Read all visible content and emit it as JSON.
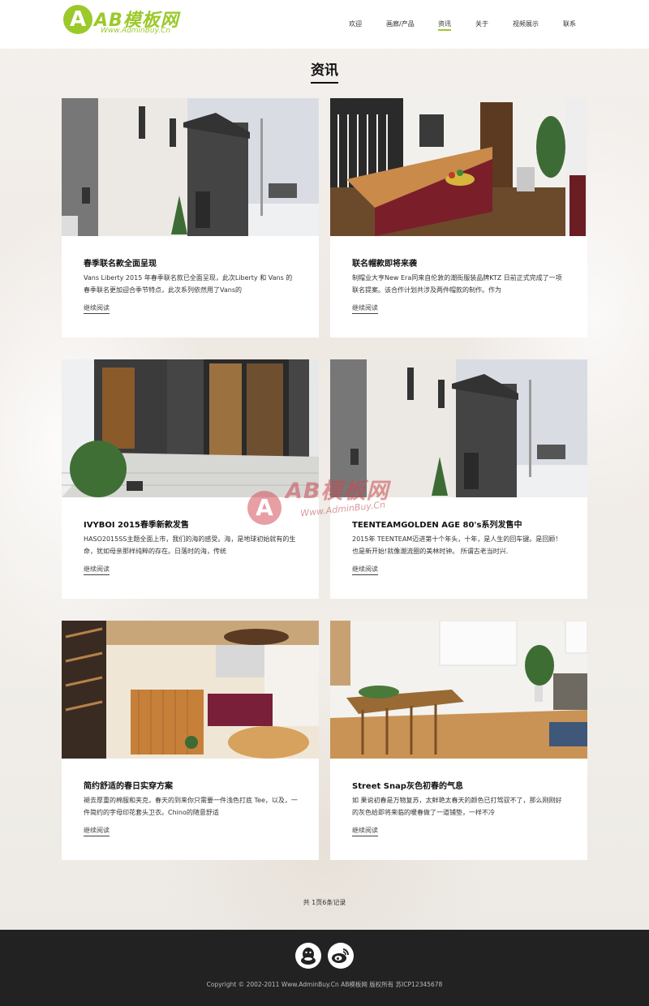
{
  "header": {
    "logo": {
      "mark": "A",
      "text": "AB模板网",
      "subtext": "Www.AdminBuy.Cn"
    },
    "nav": [
      {
        "label": "欢迎",
        "active": false
      },
      {
        "label": "画廊/产品",
        "active": false
      },
      {
        "label": "资讯",
        "active": true
      },
      {
        "label": "关于",
        "active": false
      },
      {
        "label": "视频展示",
        "active": false
      },
      {
        "label": "联系",
        "active": false
      }
    ],
    "accent_color": "#9bc92a"
  },
  "main": {
    "title": "资讯",
    "articles": [
      {
        "title": "春季联名款全面呈现",
        "excerpt": "Vans Liberty 2015 年春季联名款已全面呈现，此次Liberty 和 Vans 的春季联名更加迎合季节特点，此次系列依然用了Vans的",
        "more": "继续阅读",
        "image": "house-exterior-snow"
      },
      {
        "title": "联名帽款即将来袭",
        "excerpt": "制帽业大亨New Era同来自伦敦的潮街服装品牌KTZ 日前正式完成了一项联名提案。该合作计划共涉及两件帽款的制作。作为",
        "more": "继续阅读",
        "image": "kitchen-interior"
      },
      {
        "title": "IVYBOI 2015春季新款发售",
        "excerpt": "HASO2015SS主题全面上市，我们的海的感受。海，是地球初始就有的生命，犹如母亲那样纯粹的存在。日落时的海，传统",
        "more": "继续阅读",
        "image": "patio-glass-door"
      },
      {
        "title": "TEENTEAMGOLDEN AGE 80's系列发售中",
        "excerpt": "2015年 TEENTEAM迈进第十个年头，十年，是人生的回车键。是回顾！也是新开始!就像潮流圈的美林时钟。 所谓古老当时兴.",
        "more": "继续阅读",
        "image": "house-exterior-snow"
      },
      {
        "title": "简约舒适的春日实穿方案",
        "excerpt": "褪去厚重的棉服和夹克，春天的到来你只需要一件浅色打底 Tee，以及，一件简约的字母印花套头卫衣。Chino的随意舒适",
        "more": "继续阅读",
        "image": "wood-kitchen-dining"
      },
      {
        "title": "Street Snap灰色初春的气息",
        "excerpt": "如 果说初春是万物复苏，太鲜艳太春天的颜色已打驾驭不了，那么刚刚好的灰色给即将来临的暖春做了一道铺垫，一样不冷",
        "more": "继续阅读",
        "image": "living-dining-room"
      }
    ]
  },
  "watermark": {
    "mark": "A",
    "text": "AB模板网",
    "subtext": "Www.AdminBuy.Cn"
  },
  "pagination": {
    "text": "共 1页6条记录"
  },
  "footer": {
    "social": [
      {
        "icon": "qq-icon"
      },
      {
        "icon": "weibo-icon"
      }
    ],
    "copyright": "Copyright © 2002-2011 Www.AdminBuy.Cn AB模板网 版权所有    苏ICP12345678"
  }
}
